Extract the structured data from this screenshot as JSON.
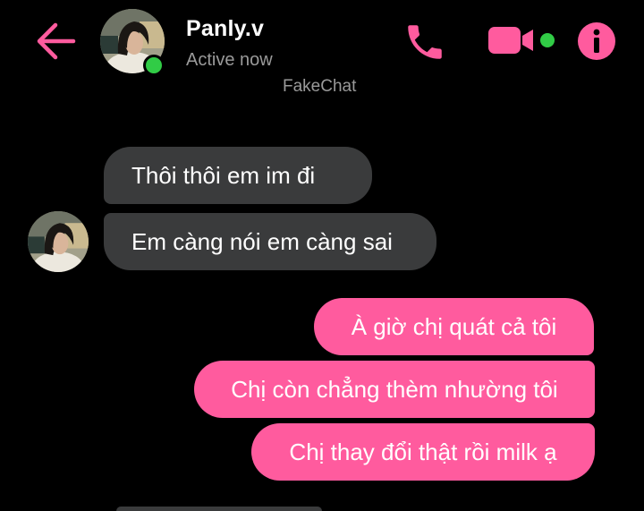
{
  "header": {
    "contact_name": "Panly.v",
    "status": "Active now",
    "watermark": "FakeChat",
    "icons": {
      "back": "arrow-left-icon",
      "call": "phone-icon",
      "video": "video-camera-icon",
      "info": "info-icon"
    }
  },
  "messages": [
    {
      "direction": "incoming",
      "text": "Thôi thôi em im  đi"
    },
    {
      "direction": "incoming",
      "text": "Em càng nói em càng sai"
    },
    {
      "direction": "outgoing",
      "text": "À giờ chị quát cả tôi"
    },
    {
      "direction": "outgoing",
      "text": "Chị còn chẳng thèm nhường tôi"
    },
    {
      "direction": "outgoing",
      "text": "Chị thay đổi thật rồi milk ạ"
    }
  ],
  "colors": {
    "background": "#000000",
    "accent": "#ff5b9e",
    "incoming_bubble": "#3a3b3c",
    "online": "#31cc46",
    "muted_text": "#9a9a9a"
  }
}
